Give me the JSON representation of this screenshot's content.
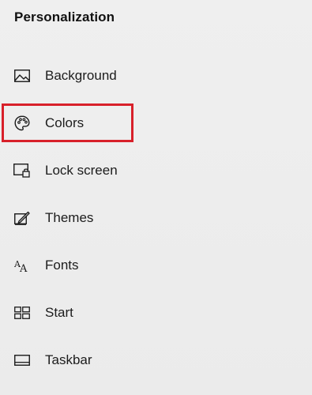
{
  "header": {
    "title": "Personalization"
  },
  "nav": {
    "items": [
      {
        "label": "Background",
        "icon": "image-icon"
      },
      {
        "label": "Colors",
        "icon": "palette-icon",
        "highlighted": true
      },
      {
        "label": "Lock screen",
        "icon": "lock-screen-icon"
      },
      {
        "label": "Themes",
        "icon": "themes-icon"
      },
      {
        "label": "Fonts",
        "icon": "fonts-icon"
      },
      {
        "label": "Start",
        "icon": "start-icon"
      },
      {
        "label": "Taskbar",
        "icon": "taskbar-icon"
      }
    ]
  },
  "colors": {
    "highlight_border": "#d8202a",
    "background": "#ececec",
    "text": "#1c1c1c"
  }
}
